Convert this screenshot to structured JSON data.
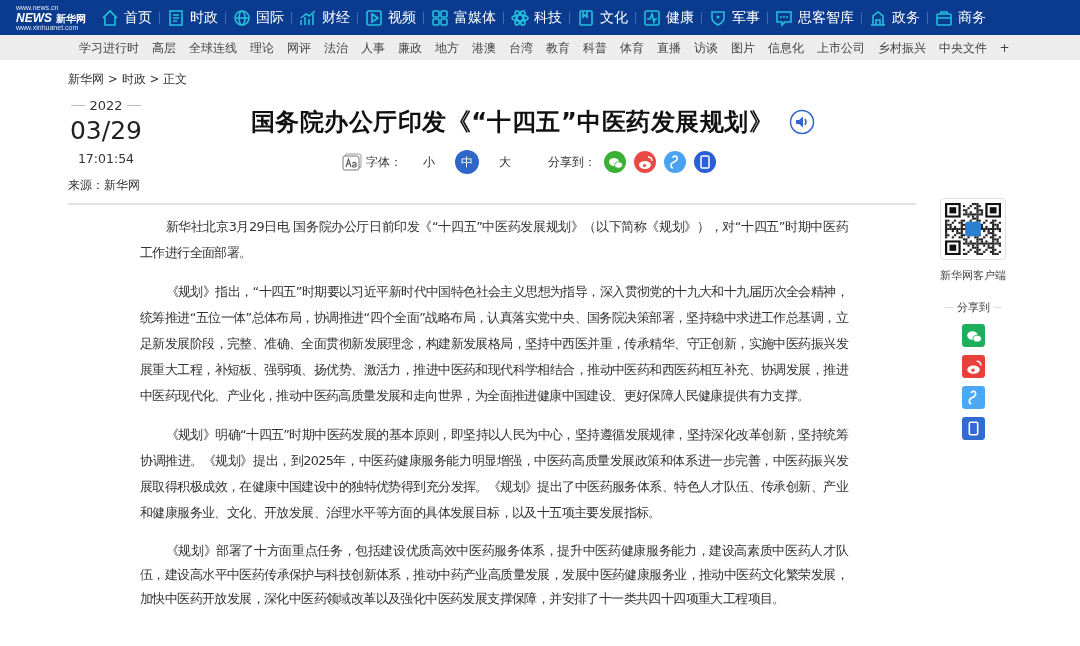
{
  "header": {
    "logo": {
      "site": "www.news.cn",
      "name": "新华网",
      "mark": "NEWS",
      "url": "www.xinhuanet.com"
    },
    "nav": [
      {
        "label": "首页"
      },
      {
        "label": "时政"
      },
      {
        "label": "国际"
      },
      {
        "label": "财经"
      },
      {
        "label": "视频"
      },
      {
        "label": "富媒体"
      },
      {
        "label": "科技"
      },
      {
        "label": "文化"
      },
      {
        "label": "健康"
      },
      {
        "label": "军事"
      },
      {
        "label": "思客智库"
      },
      {
        "label": "政务"
      },
      {
        "label": "商务"
      }
    ]
  },
  "subnav": {
    "items": [
      "学习进行时",
      "高层",
      "全球连线",
      "理论",
      "网评",
      "法治",
      "人事",
      "廉政",
      "地方",
      "港澳",
      "台湾",
      "教育",
      "科普",
      "体育",
      "直播",
      "访谈",
      "图片",
      "信息化",
      "上市公司",
      "乡村振兴",
      "中央文件"
    ],
    "more": "+"
  },
  "breadcrumb": [
    "新华网",
    ">",
    "时政",
    ">",
    "正文"
  ],
  "article": {
    "date": {
      "year": "2022",
      "day": "03/29",
      "time": "17:01:54",
      "source": "来源：新华网"
    },
    "title": "国务院办公厅印发《“十四五”中医药发展规划》",
    "font_size": {
      "label": "字体：",
      "options": [
        {
          "label": "小",
          "selected": false
        },
        {
          "label": "中",
          "selected": true
        },
        {
          "label": "大",
          "selected": false
        }
      ]
    },
    "share_label": "分享到：",
    "paragraphs": [
      "新华社北京3月29日电 国务院办公厅日前印发《“十四五”中医药发展规划》（以下简称《规划》），对“十四五”时期中医药工作进行全面部署。",
      "《规划》指出，“十四五”时期要以习近平新时代中国特色社会主义思想为指导，深入贯彻党的十九大和十九届历次全会精神，统筹推进“五位一体”总体布局，协调推进“四个全面”战略布局，认真落实党中央、国务院决策部署，坚持稳中求进工作总基调，立足新发展阶段，完整、准确、全面贯彻新发展理念，构建新发展格局，坚持中西医并重，传承精华、守正创新，实施中医药振兴发展重大工程，补短板、强弱项、扬优势、激活力，推进中医药和现代科学相结合，推动中医药和西医药相互补充、协调发展，推进中医药现代化、产业化，推动中医药高质量发展和走向世界，为全面推进健康中国建设、更好保障人民健康提供有力支撑。",
      "《规划》明确“十四五”时期中医药发展的基本原则，即坚持以人民为中心，坚持遵循发展规律，坚持深化改革创新，坚持统筹协调推进。《规划》提出，到2025年，中医药健康服务能力明显增强，中医药高质量发展政策和体系进一步完善，中医药振兴发展取得积极成效，在健康中国建设中的独特优势得到充分发挥。《规划》提出了中医药服务体系、特色人才队伍、传承创新、产业和健康服务业、文化、开放发展、治理水平等方面的具体发展目标，以及十五项主要发展指标。",
      "《规划》部署了十方面重点任务，包括建设优质高效中医药服务体系，提升中医药健康服务能力，建设高素质中医药人才队伍，建设高水平中医药传承保护与科技创新体系，推动中药产业高质量发展，发展中医药健康服务业，推动中医药文化繁荣发展，加快中医药开放发展，深化中医药领域改革以及强化中医药发展支撑保障，并安排了十一类共四十四项重大工程项目。"
    ]
  },
  "sidebar": {
    "qr_caption": "新华网客户端",
    "share_label": "分享到"
  }
}
